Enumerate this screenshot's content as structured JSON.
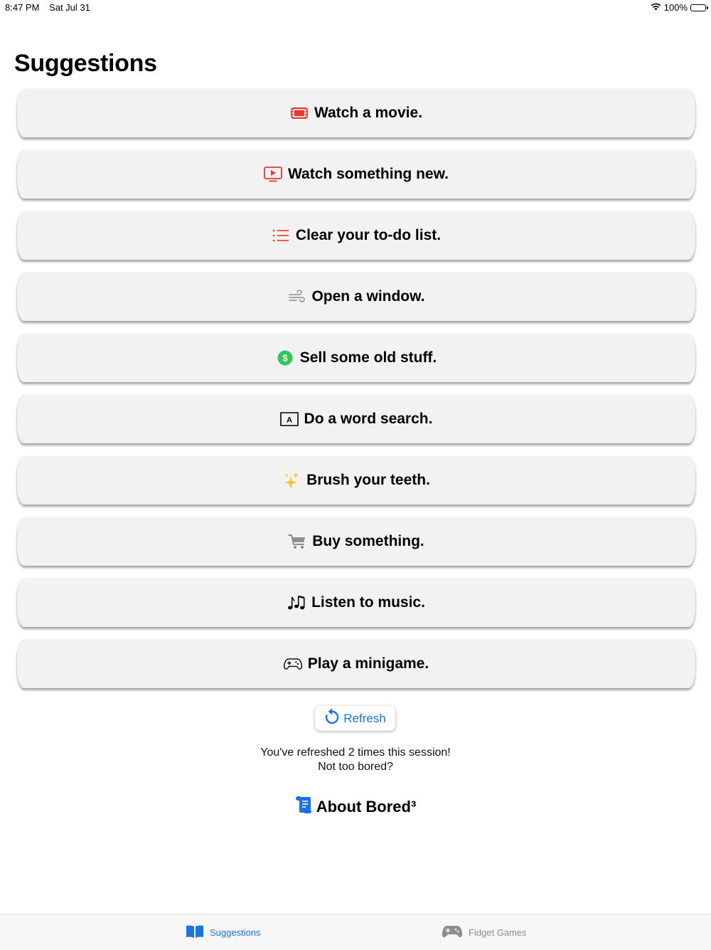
{
  "status_bar": {
    "time": "8:47 PM",
    "date": "Sat Jul 31",
    "battery": "100%"
  },
  "page_title": "Suggestions",
  "suggestions": [
    {
      "label": "Watch a movie.",
      "icon": "film-ticket-icon"
    },
    {
      "label": "Watch something new.",
      "icon": "tv-play-icon"
    },
    {
      "label": "Clear your to-do list.",
      "icon": "list-icon"
    },
    {
      "label": "Open a window.",
      "icon": "wind-icon"
    },
    {
      "label": "Sell some old stuff.",
      "icon": "dollar-circle-icon"
    },
    {
      "label": "Do a word search.",
      "icon": "text-box-icon"
    },
    {
      "label": "Brush your teeth.",
      "icon": "sparkles-icon"
    },
    {
      "label": "Buy something.",
      "icon": "cart-icon"
    },
    {
      "label": "Listen to music.",
      "icon": "music-notes-icon"
    },
    {
      "label": "Play a minigame.",
      "icon": "gamecontroller-icon"
    }
  ],
  "refresh": {
    "label": "Refresh"
  },
  "session": {
    "line1": "You've refreshed 2 times this session!",
    "line2": "Not too bored?"
  },
  "about": {
    "label": "About Bored³"
  },
  "tabs": [
    {
      "label": "Suggestions",
      "selected": true
    },
    {
      "label": "Fidget Games",
      "selected": false
    }
  ],
  "colors": {
    "accent": "#1a73e8",
    "red": "#e8392e",
    "green": "#34c759",
    "card_bg": "#f2f2f2"
  }
}
